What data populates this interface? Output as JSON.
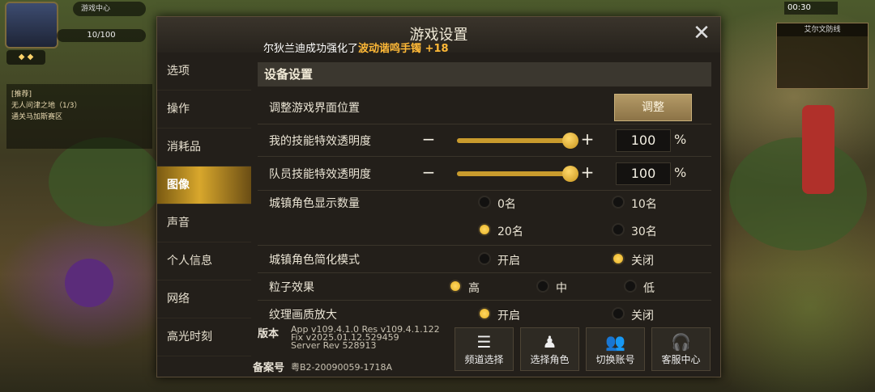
{
  "hud": {
    "hp_text": "10/100",
    "top_notice": "游戏中心",
    "quest_lines": [
      "[推荐]",
      "无人问津之地（1/3）",
      "通关马加斯赛区"
    ],
    "clock": "00:30",
    "minimap_title": "艾尔文防线"
  },
  "dialog": {
    "title": "游戏设置",
    "notice_prefix": "尔狄兰迪成功强化了",
    "notice_item": "波动谐鸣手镯",
    "notice_suffix": " +18"
  },
  "nav": {
    "items": [
      "选项",
      "操作",
      "消耗品",
      "图像",
      "声音",
      "个人信息",
      "网络",
      "高光时刻"
    ],
    "active_index": 3
  },
  "section": {
    "title": "设备设置"
  },
  "settings": {
    "ui_position": {
      "label": "调整游戏界面位置",
      "button": "调整"
    },
    "my_skill_opacity": {
      "label": "我的技能特效透明度",
      "value": "100",
      "unit": "%",
      "minus": "−",
      "plus": "+",
      "level": 1.0
    },
    "team_skill_opacity": {
      "label": "队员技能特效透明度",
      "value": "100",
      "unit": "%",
      "minus": "−",
      "plus": "+",
      "level": 1.0
    },
    "town_count": {
      "label": "城镇角色显示数量",
      "options": [
        "0名",
        "10名",
        "20名",
        "30名"
      ],
      "selected": "20名"
    },
    "town_simple": {
      "label": "城镇角色简化模式",
      "options": [
        "开启",
        "关闭"
      ],
      "selected": "关闭"
    },
    "particle": {
      "label": "粒子效果",
      "options": [
        "高",
        "中",
        "低"
      ],
      "selected": "高"
    },
    "texture_upscale": {
      "label": "纹理画质放大",
      "options": [
        "开启",
        "关闭"
      ],
      "selected": "开启"
    }
  },
  "footer": {
    "version_label": "版本",
    "version_lines": [
      "App v109.4.1.0 Res v109.4.1.122",
      "Fix v2025.01.12.529459",
      "Server Rev 528913"
    ],
    "record_label": "备案号",
    "record_value": "粤B2-20090059-1718A",
    "buttons": [
      {
        "label": "频道选择",
        "icon": "channel-list-icon"
      },
      {
        "label": "选择角色",
        "icon": "character-icon"
      },
      {
        "label": "切换账号",
        "icon": "switch-account-icon"
      },
      {
        "label": "客服中心",
        "icon": "customer-service-icon"
      }
    ]
  },
  "colors": {
    "accent_gold": "#d8a72c",
    "highlight_orange": "#ffb937",
    "panel": "#231f1a"
  }
}
